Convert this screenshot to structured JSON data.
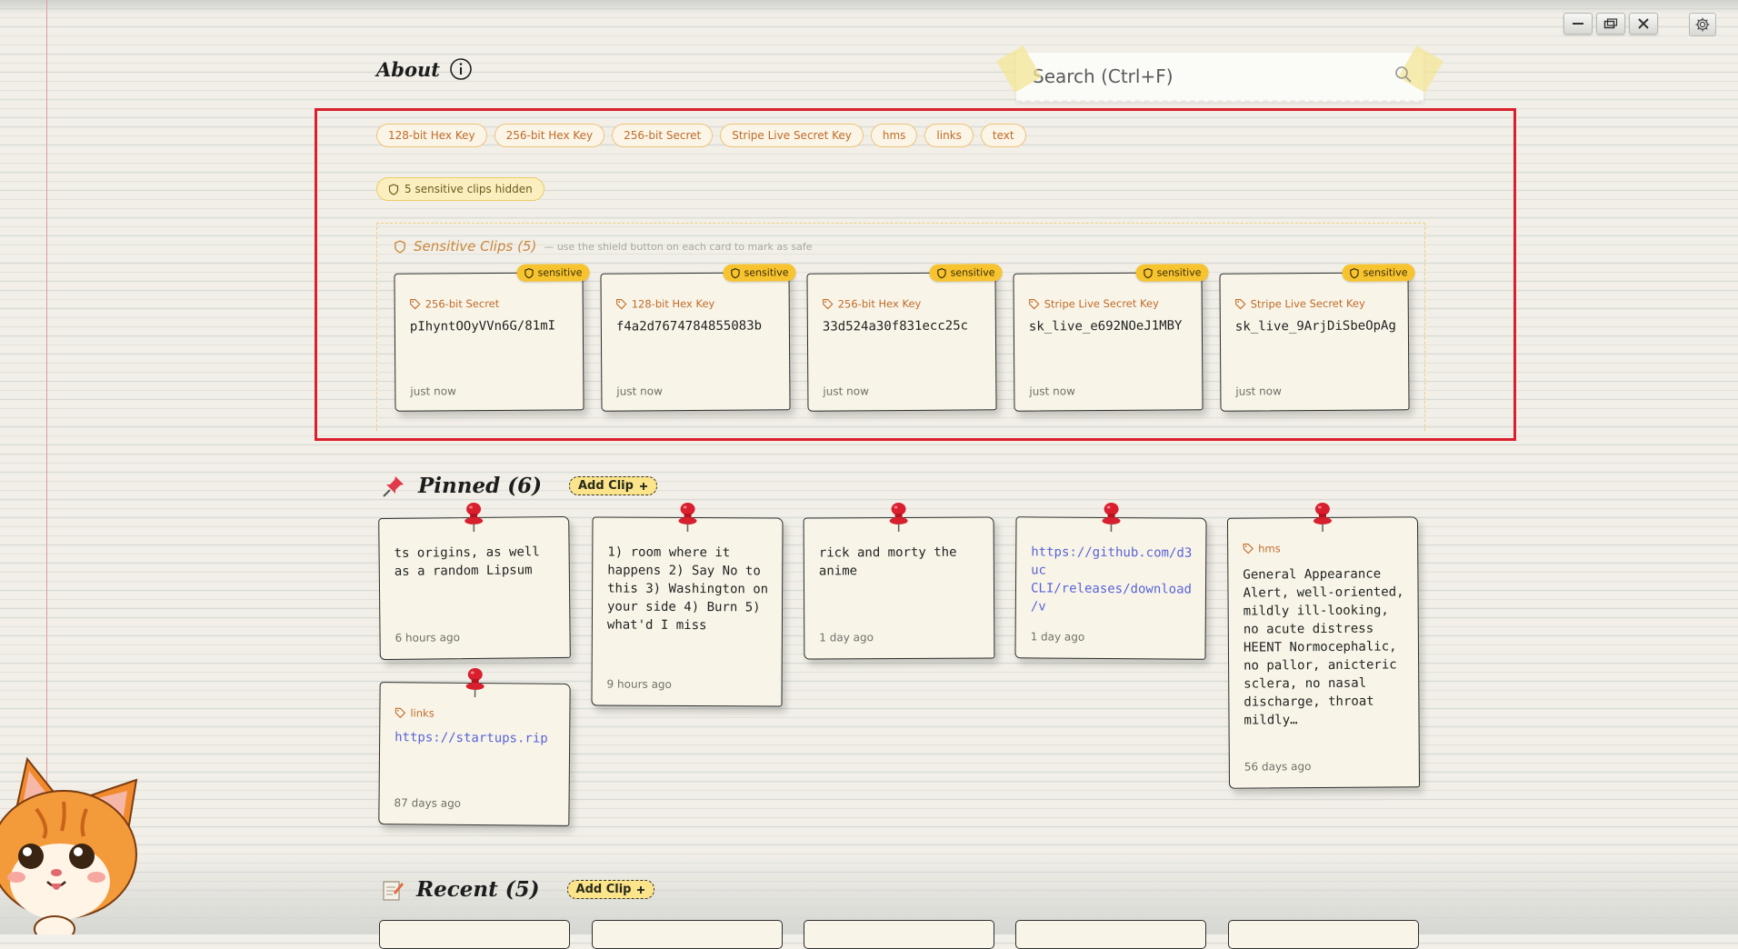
{
  "window": {
    "controls": [
      "minimize-icon",
      "restore-icon",
      "close-icon",
      "gear-icon"
    ]
  },
  "header": {
    "title": "About",
    "info_icon": "info-icon"
  },
  "search": {
    "placeholder": "Search (Ctrl+F)",
    "icon": "search-icon"
  },
  "tag_filters": [
    "128-bit Hex Key",
    "256-bit Hex Key",
    "256-bit Secret",
    "Stripe Live Secret Key",
    "hms",
    "links",
    "text"
  ],
  "hidden_notice": "5 sensitive clips hidden",
  "sensitive": {
    "title": "Sensitive Clips (5)",
    "note": "— use the shield button on each card to mark as safe",
    "badge": "sensitive",
    "cards": [
      {
        "tag": "256-bit Secret",
        "value": "pIhyntOOyVVn6G/81mI",
        "time": "just now"
      },
      {
        "tag": "128-bit Hex Key",
        "value": "f4a2d7674784855083b",
        "time": "just now"
      },
      {
        "tag": "256-bit Hex Key",
        "value": "33d524a30f831ecc25c",
        "time": "just now"
      },
      {
        "tag": "Stripe Live Secret Key",
        "value": "sk_live_e692NOeJ1MBY",
        "time": "just now"
      },
      {
        "tag": "Stripe Live Secret Key",
        "value": "sk_live_9ArjDiSbeOpAg",
        "time": "just now"
      }
    ]
  },
  "pinned": {
    "title": "Pinned (6)",
    "add_label": "Add Clip",
    "notes": [
      {
        "text": "ts origins, as well as a random Lipsum",
        "time": "6 hours ago"
      },
      {
        "text": "1) room where it happens 2) Say No to this 3) Washington on your side 4) Burn 5) what'd I miss",
        "time": "9 hours ago"
      },
      {
        "text": "rick and morty the anime",
        "time": "1 day ago"
      },
      {
        "text": "https://github.com/d3uc CLI/releases/download/v",
        "time": "1 day ago"
      },
      {
        "tag": "hms",
        "text": "General Appearance Alert, well-oriented, mildly ill-looking, no acute distress HEENT Normocephalic, no pallor, anicteric sclera, no nasal discharge, throat mildly…",
        "time": "56 days ago"
      },
      {
        "tag": "links",
        "text": "https://startups.rip",
        "time": "87 days ago"
      }
    ]
  },
  "recent": {
    "title": "Recent (5)",
    "add_label": "Add Clip"
  },
  "colors": {
    "accent": "#f7c32e",
    "tag_text": "#c06b2a",
    "link": "#5a62d8",
    "highlight": "#d9202c"
  }
}
